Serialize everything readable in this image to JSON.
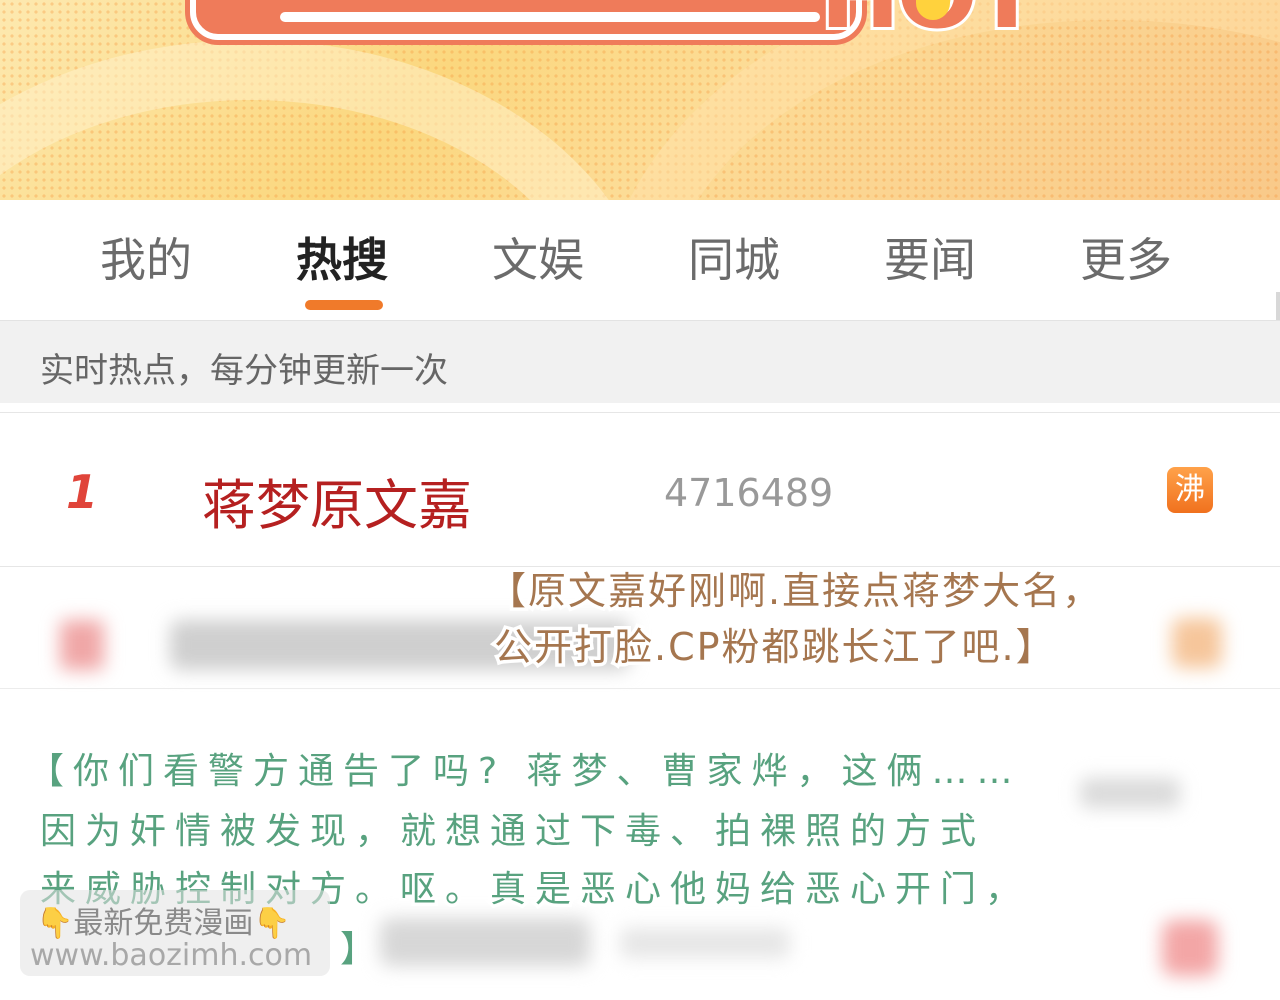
{
  "tabs": [
    {
      "label": "我的"
    },
    {
      "label": "热搜"
    },
    {
      "label": "文娱"
    },
    {
      "label": "同城"
    },
    {
      "label": "要闻"
    },
    {
      "label": "更多"
    }
  ],
  "active_tab": "热搜",
  "subheader": "实时热点，每分钟更新一次",
  "hot_list": [
    {
      "rank": "1",
      "title": "蒋梦原文嘉",
      "count": "4716489",
      "badge": "沸"
    }
  ],
  "captions": {
    "brown": {
      "line1": "【原文嘉好刚啊.直接点蒋梦大名，",
      "line2": "公开打脸.CP粉都跳长江了吧.】"
    },
    "green": {
      "line1": "【你们看警方通告了吗? 蒋梦、曹家烨，这俩……",
      "line2": "因为奸情被发现，就想通过下毒、拍裸照的方式",
      "line3": "来威胁控制对方。呕。真是恶心他妈给恶心开门，",
      "line4": "】"
    }
  },
  "watermark": {
    "line1": "👇最新免费漫画👇",
    "line2": "www.baozimh.com"
  },
  "colors": {
    "accent": "#f07a2a",
    "hot_title": "#b52020",
    "rank": "#e0443a",
    "caption_brown": "#a5764f",
    "caption_green": "#58a27f"
  }
}
